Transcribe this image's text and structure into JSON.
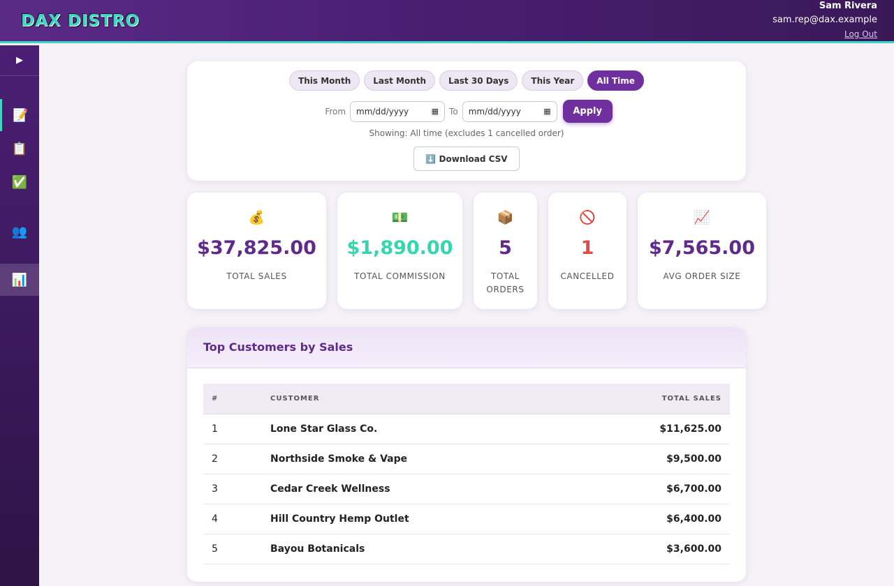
{
  "header": {
    "logo": "DAX DISTRO",
    "user_name": "Sam Rivera",
    "user_email": "sam.rep@dax.example",
    "logout": "Log Out"
  },
  "sidebar": {
    "toggle": "▶",
    "items": [
      {
        "icon": "📝",
        "name": "orders-entry-icon"
      },
      {
        "icon": "📋",
        "name": "clipboard-icon"
      },
      {
        "icon": "✅",
        "name": "checkmark-icon"
      },
      {
        "icon": "👥",
        "name": "customers-icon"
      },
      {
        "icon": "📊",
        "name": "reports-icon"
      }
    ]
  },
  "filters": {
    "ranges": [
      "This Month",
      "Last Month",
      "Last 30 Days",
      "This Year",
      "All Time"
    ],
    "selected": "All Time",
    "from_label": "From",
    "to_label": "To",
    "from_placeholder": "mm/dd/yyyy",
    "to_placeholder": "mm/dd/yyyy",
    "apply": "Apply",
    "showing": "Showing: All time (excludes 1 cancelled order)",
    "download": "⬇️ Download CSV"
  },
  "stats": [
    {
      "icon": "💰",
      "value": "$37,825.00",
      "label": "Total Sales"
    },
    {
      "icon": "💵",
      "value": "$1,890.00",
      "label": "Total Commission"
    },
    {
      "icon": "📦",
      "value": "5",
      "label": "Total Orders"
    },
    {
      "icon": "🚫",
      "value": "1",
      "label": "Cancelled"
    },
    {
      "icon": "📈",
      "value": "$7,565.00",
      "label": "Avg Order Size"
    }
  ],
  "top_customers": {
    "title": "Top Customers by Sales",
    "columns": [
      "#",
      "CUSTOMER",
      "TOTAL SALES"
    ],
    "rows": [
      {
        "rank": "1",
        "customer": "Lone Star Glass Co.",
        "total": "$11,625.00"
      },
      {
        "rank": "2",
        "customer": "Northside Smoke & Vape",
        "total": "$9,500.00"
      },
      {
        "rank": "3",
        "customer": "Cedar Creek Wellness",
        "total": "$6,700.00"
      },
      {
        "rank": "4",
        "customer": "Hill Country Hemp Outlet",
        "total": "$6,400.00"
      },
      {
        "rank": "5",
        "customer": "Bayou Botanicals",
        "total": "$3,600.00"
      }
    ]
  },
  "colors": {
    "brand_purple": "#6f2f9e",
    "accent_teal": "#3ed6c2",
    "commission_green": "#35d5b0",
    "cancel_red": "#e24a4a"
  }
}
